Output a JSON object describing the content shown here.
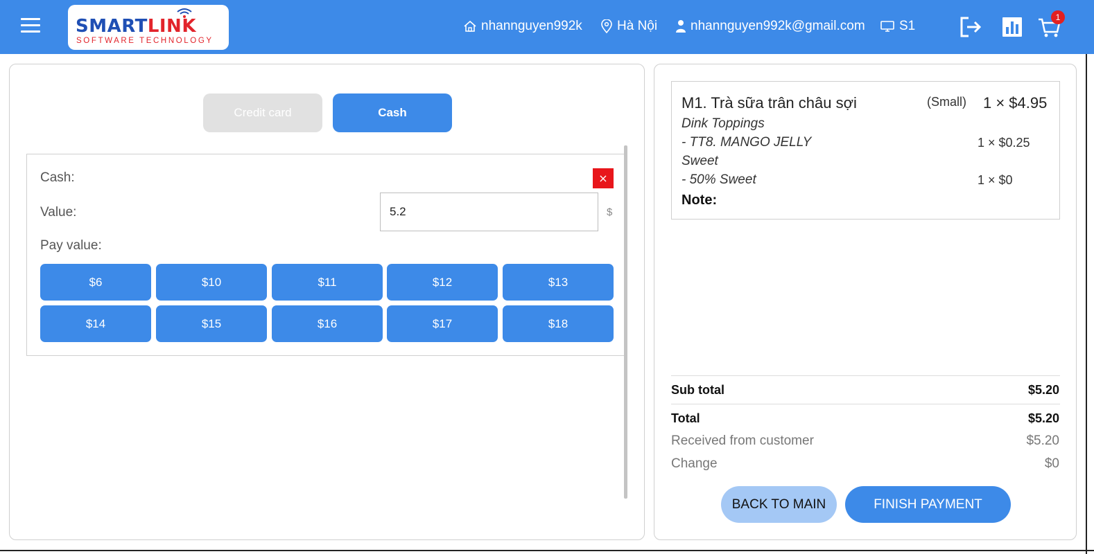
{
  "header": {
    "logo": {
      "word1": "SMART",
      "word2": "LINK",
      "tagline": "SOFTWARE TECHNOLOGY"
    },
    "username": "nhannguyen992k",
    "location": "Hà Nội",
    "email": "nhannguyen992k@gmail.com",
    "station": "S1",
    "cart_count": "1",
    "icons": [
      "menu-icon",
      "home-icon",
      "location-pin-icon",
      "user-icon",
      "monitor-icon",
      "logout-icon",
      "bar-chart-icon",
      "cart-icon"
    ],
    "colors": {
      "header_bg": "#3d8ae8",
      "badge": "#e32020"
    }
  },
  "payment": {
    "tabs": [
      {
        "label": "Credit card",
        "active": false
      },
      {
        "label": "Cash",
        "active": true
      }
    ],
    "cash_label": "Cash:",
    "value_label": "Value:",
    "value": "5.2",
    "currency": "$",
    "pay_value_label": "Pay value:",
    "close_symbol": "×",
    "pay_values": [
      "$6",
      "$10",
      "$11",
      "$12",
      "$13",
      "$14",
      "$15",
      "$16",
      "$17",
      "$18"
    ]
  },
  "order": {
    "item_name": "M1. Trà sữa trân châu sợi",
    "size": "(Small)",
    "qty_price": "1 × $4.95",
    "topping_group": "Dink Toppings",
    "topping": "- TT8. MANGO JELLY",
    "topping_qty": "1 × $0.25",
    "sweet_group": "Sweet",
    "sweet": "- 50% Sweet",
    "sweet_qty": "1 × $0",
    "note_label": "Note:"
  },
  "summary": {
    "subtotal_label": "Sub total",
    "subtotal": "$5.20",
    "total_label": "Total",
    "total": "$5.20",
    "received_label": "Received from customer",
    "received": "$5.20",
    "change_label": "Change",
    "change": "$0"
  },
  "actions": {
    "back": "BACK TO MAIN",
    "finish": "FINISH PAYMENT"
  }
}
